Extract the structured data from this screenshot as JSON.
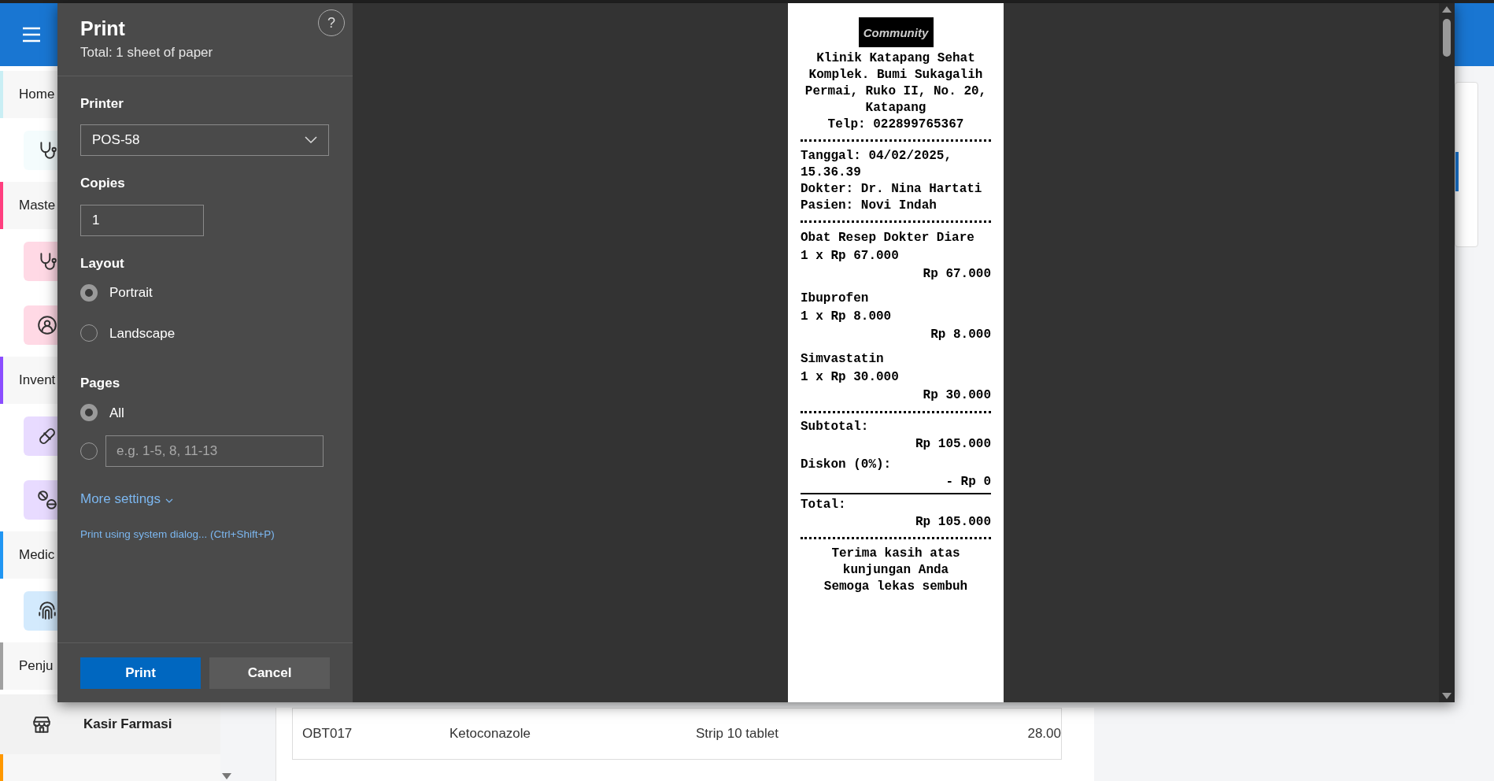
{
  "app": {
    "sidebar": {
      "sections": [
        {
          "label": "Home",
          "color": "#c9eef4",
          "items": [
            {
              "kind": "stethoscope"
            }
          ]
        },
        {
          "label": "Maste",
          "color": "#ff3f7f",
          "items": [
            {
              "kind": "stethoscope"
            },
            {
              "kind": "user"
            }
          ]
        },
        {
          "label": "Invent",
          "color": "#8b4dff",
          "items": [
            {
              "kind": "pill"
            },
            {
              "kind": "pills"
            }
          ]
        },
        {
          "label": "Medic",
          "color": "#2196f3",
          "items": [
            {
              "kind": "fingerprint"
            }
          ]
        },
        {
          "label": "Penju",
          "color": "#a0a0a0",
          "items": [
            {
              "kind": "store",
              "label": "Kasir Farmasi"
            }
          ]
        },
        {
          "color": "#ff9800"
        }
      ]
    },
    "table_rows": [
      {
        "cells": [
          "OBT017",
          "Ketoconazole",
          "Strip 10 tablet",
          "28.00"
        ]
      }
    ]
  },
  "print_dialog": {
    "title": "Print",
    "subtitle": "Total: 1 sheet of paper",
    "help": "?",
    "printer": {
      "label": "Printer",
      "value": "POS-58"
    },
    "copies": {
      "label": "Copies",
      "value": "1"
    },
    "layout": {
      "label": "Layout",
      "options": [
        {
          "label": "Portrait",
          "selected": true
        },
        {
          "label": "Landscape",
          "selected": false
        }
      ]
    },
    "pages": {
      "label": "Pages",
      "options": [
        {
          "kind": "all",
          "label": "All",
          "selected": true
        },
        {
          "kind": "range",
          "placeholder": "e.g. 1-5, 8, 11-13",
          "selected": false
        }
      ]
    },
    "more_settings": "More settings",
    "system_dialog_link": "Print using system dialog... (Ctrl+Shift+P)",
    "buttons": [
      {
        "kind": "primary",
        "label": "Print"
      },
      {
        "kind": "secondary",
        "label": "Cancel"
      }
    ]
  },
  "receipt": {
    "logo_text": "Community",
    "clinic": "Klinik Katapang Sehat",
    "address": "Komplek. Bumi Sukagalih Permai, Ruko II, No. 20, Katapang",
    "phone": "Telp: 022899765367",
    "info_lines": [
      "Tanggal: 04/02/2025, 15.36.39",
      "Dokter: Dr. Nina Hartati",
      "Pasien: Novi Indah"
    ],
    "items": [
      {
        "name": "Obat Resep Dokter Diare",
        "qty_price": "1 x Rp 67.000",
        "amount": "Rp 67.000"
      },
      {
        "name": "Ibuprofen",
        "qty_price": "1 x Rp 8.000",
        "amount": "Rp 8.000"
      },
      {
        "name": "Simvastatin",
        "qty_price": "1 x Rp 30.000",
        "amount": "Rp 30.000"
      }
    ],
    "totals": [
      {
        "label": "Subtotal:",
        "value": "Rp 105.000"
      },
      {
        "label": "Diskon (0%):",
        "value": "- Rp 0"
      }
    ],
    "total": {
      "label": "Total:",
      "value": "Rp 105.000"
    },
    "footer_lines": [
      "Terima kasih atas kunjungan Anda",
      "Semoga lekas sembuh"
    ]
  }
}
